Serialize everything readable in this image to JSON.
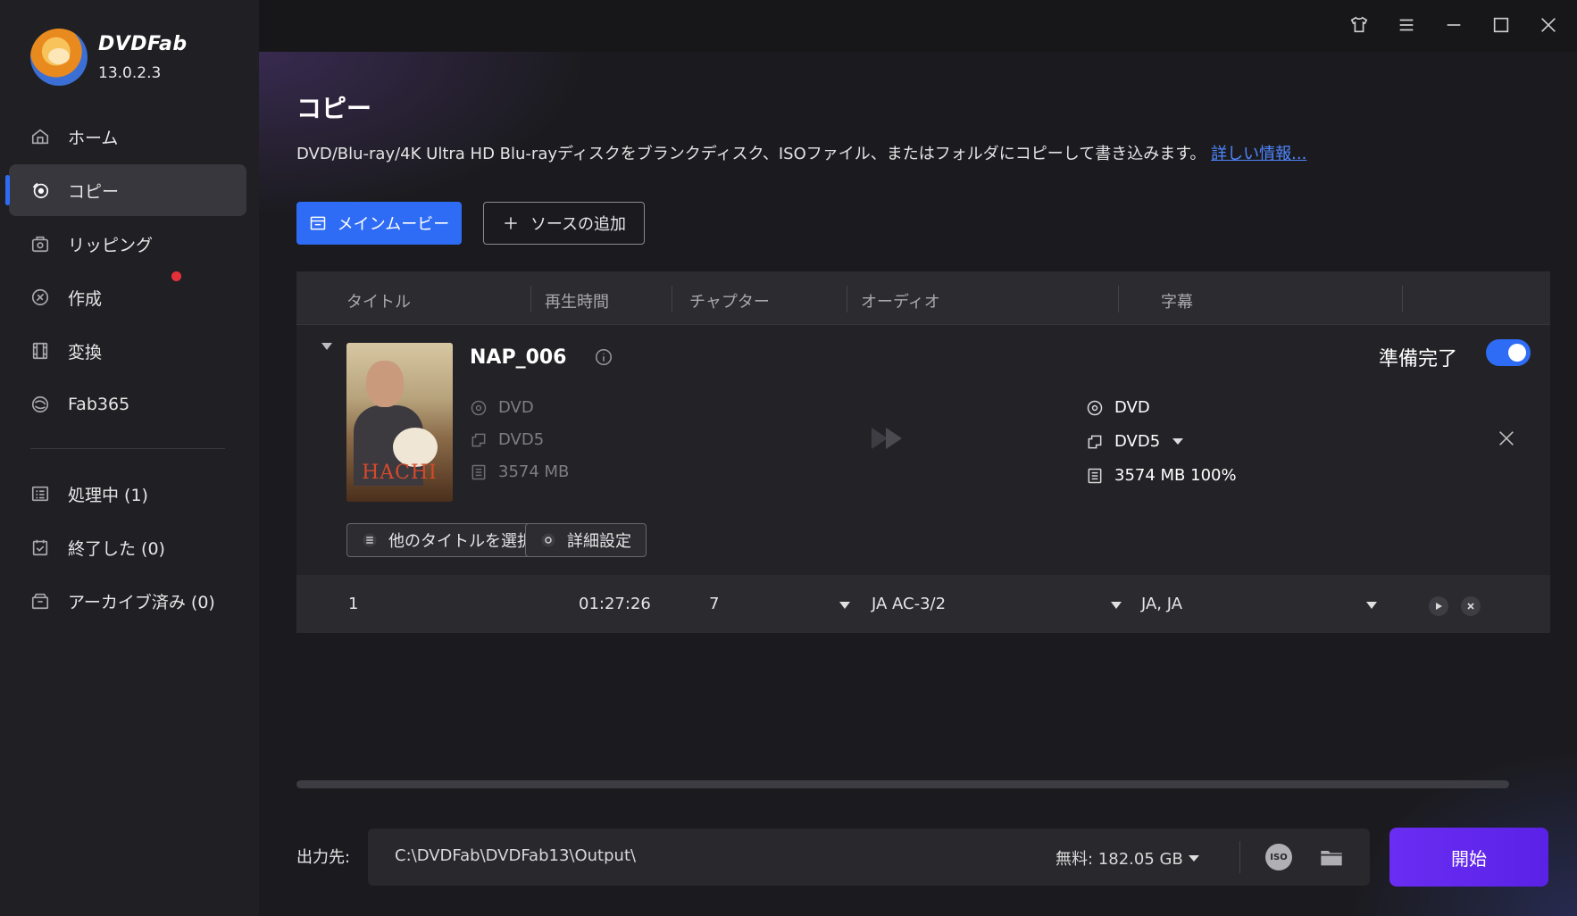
{
  "app": {
    "brand": "DVDFab",
    "version": "13.0.2.3"
  },
  "window_controls": [
    "shirt-icon",
    "menu-icon",
    "minimize-icon",
    "maximize-icon",
    "close-icon"
  ],
  "sidebar": {
    "items": [
      {
        "label": "ホーム",
        "icon": "home-icon",
        "active": false
      },
      {
        "label": "コピー",
        "icon": "copy-disc-icon",
        "active": true
      },
      {
        "label": "リッピング",
        "icon": "ripping-icon",
        "active": false
      },
      {
        "label": "作成",
        "icon": "create-icon",
        "active": false
      },
      {
        "label": "変換",
        "icon": "convert-icon",
        "active": false
      },
      {
        "label": "Fab365",
        "icon": "fab365-icon",
        "active": false,
        "badge_dot": true
      }
    ],
    "queue": [
      {
        "label": "処理中 (1)",
        "icon": "processing-icon"
      },
      {
        "label": "終了した (0)",
        "icon": "finished-icon"
      },
      {
        "label": "アーカイブ済み (0)",
        "icon": "archive-icon"
      }
    ]
  },
  "main": {
    "title": "コピー",
    "description": "DVD/Blu-ray/4K Ultra HD Blu-rayディスクをブランクディスク、ISOファイル、またはフォルダにコピーして書き込みます。",
    "more_link": "詳しい情報...",
    "mode_button": "メインムービー",
    "add_source_button": "ソースの追加",
    "columns": [
      "タイトル",
      "再生時間",
      "チャプター",
      "オーディオ",
      "字幕"
    ],
    "disc": {
      "name": "NAP_006",
      "poster_title": "HACHI",
      "source": {
        "type": "DVD",
        "format": "DVD5",
        "size": "3574 MB"
      },
      "output": {
        "type": "DVD",
        "format": "DVD5",
        "size": "3574 MB 100%"
      },
      "status": "準備完了",
      "ready_toggle_on": true,
      "select_titles_button": "他のタイトルを選択",
      "advanced_settings_button": "詳細設定"
    },
    "title_row": {
      "title": "1",
      "duration": "01:27:26",
      "chapters": "7",
      "audio": "JA  AC-3/2",
      "subtitles": "JA, JA"
    }
  },
  "output_bar": {
    "label": "出力先:",
    "path": "C:\\DVDFab\\DVDFab13\\Output\\",
    "free_space": "無料:  182.05 GB",
    "start_button": "開始"
  },
  "colors": {
    "accent_blue": "#2f6cf5",
    "start_purple": "#6a2df2",
    "notify_red": "#e5303a"
  }
}
